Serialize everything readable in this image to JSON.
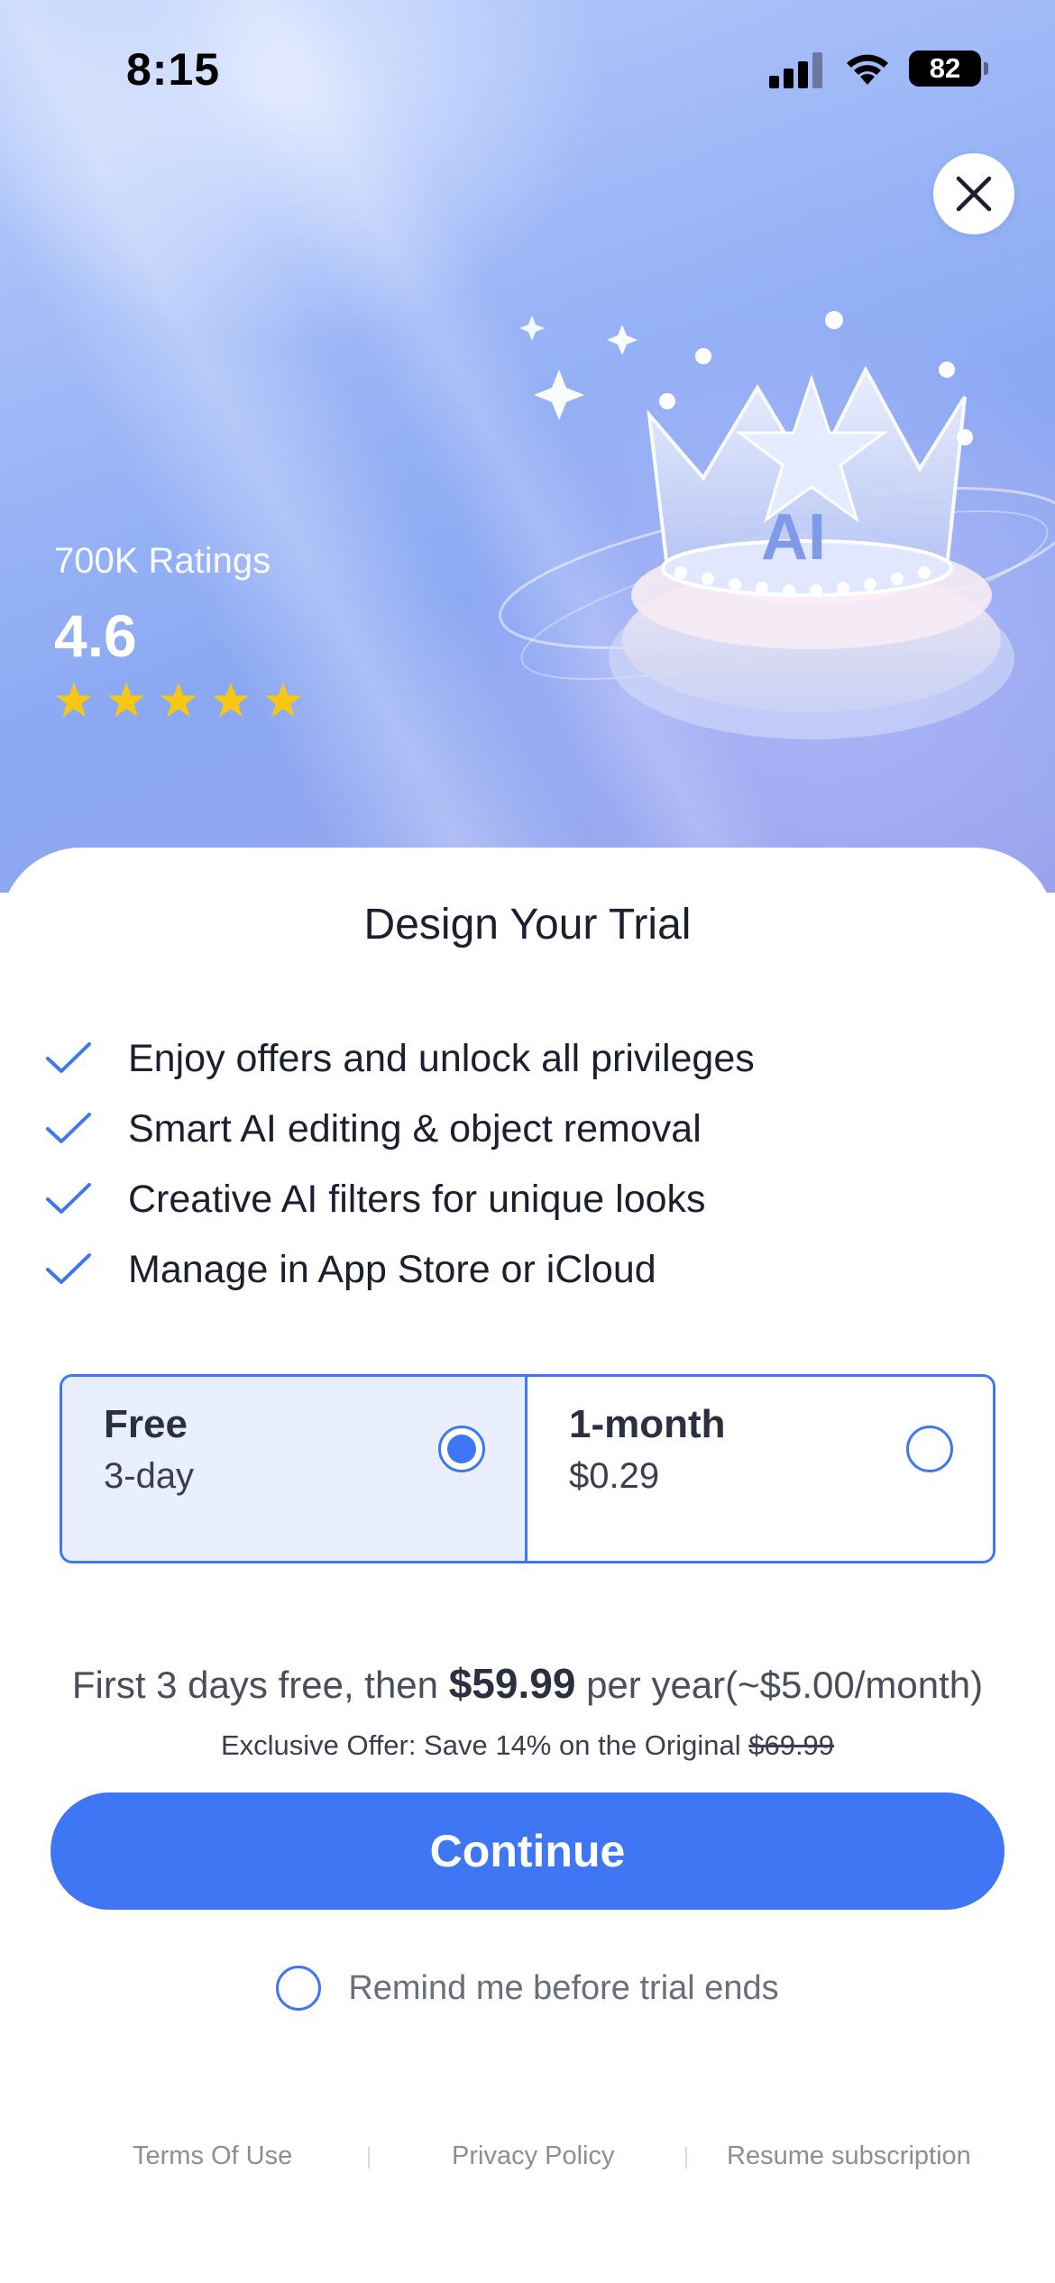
{
  "status_bar": {
    "time": "8:15",
    "battery": "82",
    "icons": [
      "signal-icon",
      "wifi-icon",
      "battery-icon"
    ]
  },
  "hero": {
    "close_icon": "close-icon",
    "ratings_count": "700K Ratings",
    "rating_score": "4.6",
    "stars": 5,
    "crown_label": "AI"
  },
  "sheet": {
    "title": "Design Your Trial",
    "features": [
      "Enjoy offers and unlock all privileges",
      "Smart AI editing & object removal",
      "Creative AI filters for unique looks",
      "Manage in App Store or iCloud"
    ],
    "plans": [
      {
        "name": "Free",
        "detail": "3-day",
        "selected": true
      },
      {
        "name": "1-month",
        "detail": "$0.29",
        "selected": false
      }
    ],
    "price": {
      "prefix": "First 3 days free, then ",
      "amount": "$59.99",
      "suffix": " per year(~$5.00/month)"
    },
    "offer": {
      "text": "Exclusive Offer: Save 14% on the Original ",
      "original_price": "$69.99"
    },
    "continue_label": "Continue",
    "remind_label": "Remind me before trial ends",
    "footer": {
      "terms": "Terms Of Use",
      "privacy": "Privacy Policy",
      "resume": "Resume subscription"
    }
  },
  "colors": {
    "accent": "#3f76f4",
    "star": "#f8c714",
    "selected_plan_bg": "#e9effe"
  }
}
